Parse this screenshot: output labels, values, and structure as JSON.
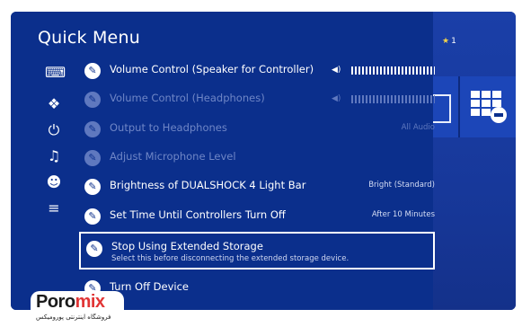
{
  "header": {
    "title": "Quick Menu"
  },
  "background": {
    "trophy_count": "1"
  },
  "menu": [
    {
      "label": "Volume Control (Speaker for Controller)",
      "value_type": "volume",
      "enabled": true
    },
    {
      "label": "Volume Control (Headphones)",
      "value_type": "volume",
      "enabled": false
    },
    {
      "label": "Output to Headphones",
      "value": "All Audio",
      "enabled": false
    },
    {
      "label": "Adjust Microphone Level",
      "value": "",
      "enabled": false
    },
    {
      "label": "Brightness of DUALSHOCK 4 Light Bar",
      "value": "Bright (Standard)",
      "enabled": true
    },
    {
      "label": "Set Time Until Controllers Turn Off",
      "value": "After 10 Minutes",
      "enabled": true
    },
    {
      "label": "Stop Using Extended Storage",
      "description": "Select this before disconnecting the extended storage device.",
      "enabled": true,
      "selected": true
    },
    {
      "label": "Turn Off Device",
      "enabled": true
    }
  ],
  "logo": {
    "brand_a": "Poro",
    "brand_b": "mix",
    "tagline": "فروشگاه اینترنتی پورومیکس"
  },
  "colors": {
    "background": "#0b2f8c",
    "dimmed_text": "#6f86c6",
    "text": "#ffffff",
    "logo_accent": "#e13535"
  }
}
